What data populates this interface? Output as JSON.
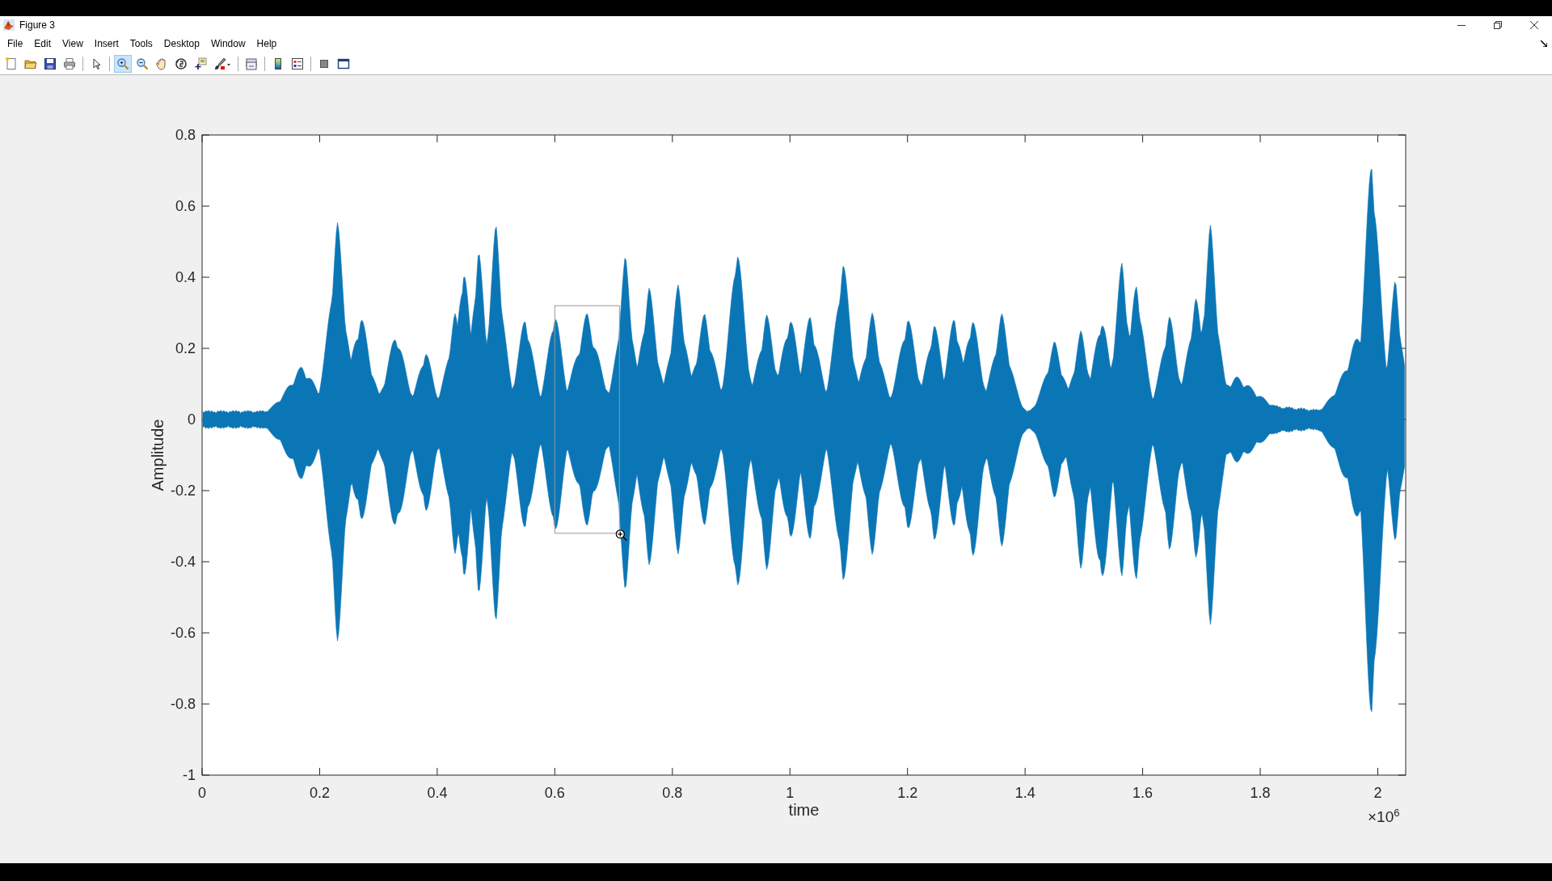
{
  "window": {
    "title": "Figure 3"
  },
  "menu": [
    "File",
    "Edit",
    "View",
    "Insert",
    "Tools",
    "Desktop",
    "Window",
    "Help"
  ],
  "toolbar": [
    {
      "tools": [
        {
          "kind": "new",
          "selected": false
        },
        {
          "kind": "open",
          "selected": false
        },
        {
          "kind": "save",
          "selected": false
        },
        {
          "kind": "print",
          "selected": false
        }
      ]
    },
    {
      "tools": [
        {
          "kind": "pointer",
          "selected": false
        }
      ]
    },
    {
      "tools": [
        {
          "kind": "zoom-in",
          "selected": true
        },
        {
          "kind": "zoom-out",
          "selected": false
        },
        {
          "kind": "pan",
          "selected": false
        },
        {
          "kind": "rotate",
          "selected": false
        },
        {
          "kind": "data-cursor",
          "selected": false
        },
        {
          "kind": "brush",
          "selected": false
        }
      ]
    },
    {
      "tools": [
        {
          "kind": "link",
          "selected": false
        }
      ]
    },
    {
      "tools": [
        {
          "kind": "colorbar",
          "selected": false
        },
        {
          "kind": "legend",
          "selected": false
        }
      ]
    },
    {
      "tools": [
        {
          "kind": "hide",
          "selected": false
        },
        {
          "kind": "dock",
          "selected": false
        }
      ]
    }
  ],
  "axes": {
    "ylabel": "Amplitude",
    "xlabel": "time",
    "x_exponent": "×10$^{6}$",
    "yticks": [
      "0.8",
      "0.6",
      "0.4",
      "0.2",
      "0",
      "-0.2",
      "-0.4",
      "-0.6",
      "-0.8",
      "-1"
    ],
    "xticks": [
      "0",
      "0.2",
      "0.4",
      "0.6",
      "0.8",
      "1",
      "1.2",
      "1.4",
      "1.6",
      "1.8",
      "2"
    ],
    "zoom_box": true
  }
}
